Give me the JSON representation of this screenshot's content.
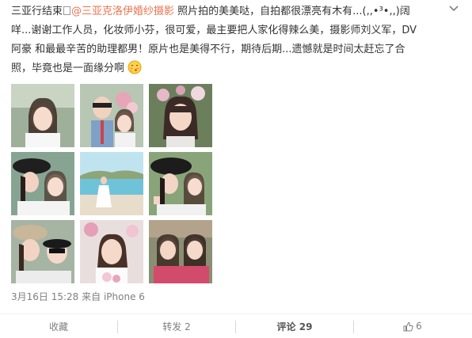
{
  "post": {
    "text_line1_prefix": "三亚行结束",
    "mention": "@三亚克洛伊婚纱摄影",
    "text_line1_suffix": " 照片拍的美美哒，自拍都很漂亮有木有...(,,•³•,,)阔",
    "text_line2": "咩...谢谢工作人员，化妆师小芬，很可爱，最主要把人家化得辣么美，摄影师刘义军，DV",
    "text_line3": "阿豪 和最最辛苦的助理都男！原片也是美得不行，期待后期...遗憾就是时间太赶忘了合",
    "text_line4": "照，毕竟也是一面缘分啊",
    "emoji": "emoji-shy",
    "time": "3月16日 15:28",
    "source": "来自 iPhone 6",
    "more_icon": "chevron-down-icon",
    "photos_count": 9
  },
  "actions": {
    "favorite": "收藏",
    "repost": "转发 2",
    "comment": "评论 29",
    "like": "6",
    "like_icon": "thumbs-up-icon"
  },
  "colors": {
    "mention": "#eb7350",
    "meta": "#808080",
    "divider": "#f2f2f5"
  }
}
